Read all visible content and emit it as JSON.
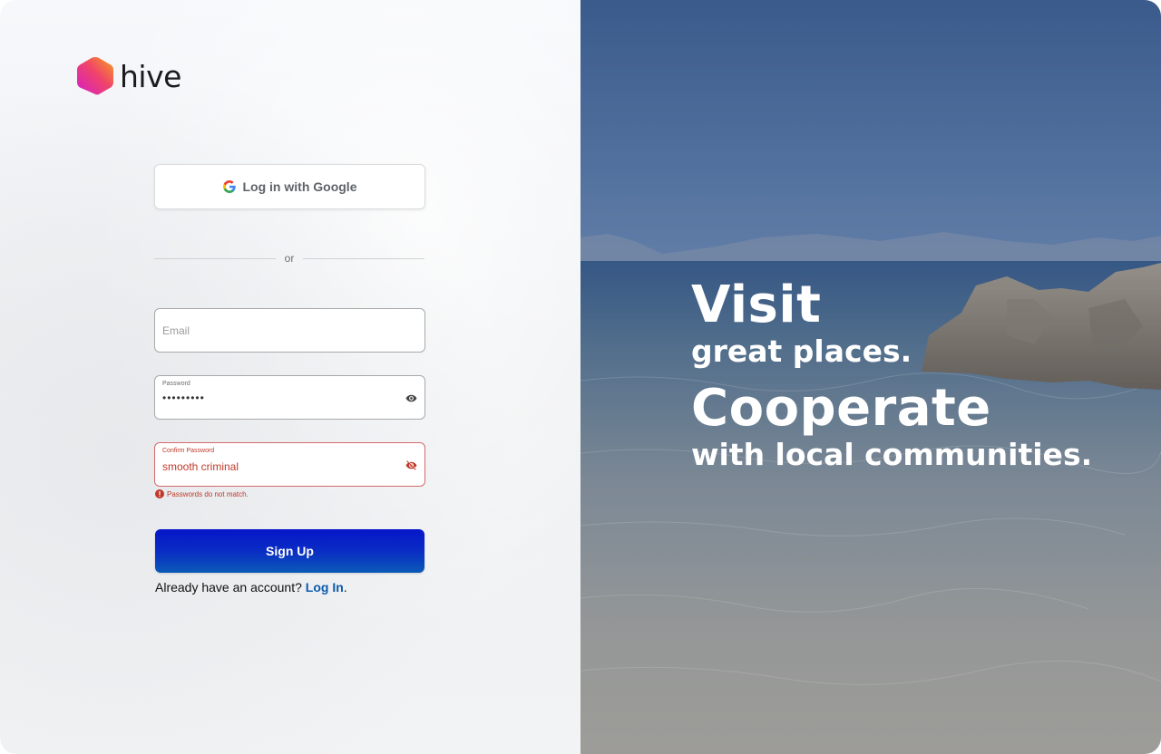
{
  "brand": {
    "name": "hive"
  },
  "auth": {
    "google_label": "Log in with Google",
    "divider_text": "or",
    "email": {
      "placeholder": "Email",
      "value": ""
    },
    "password": {
      "label": "Password",
      "value": "•••••••••"
    },
    "confirm_password": {
      "label": "Confirm Password",
      "value": "smooth criminal",
      "error": "Passwords do not match."
    },
    "signup_label": "Sign Up",
    "account_prompt": "Already have an account?",
    "login_link": "Log In",
    "login_suffix": "."
  },
  "hero": {
    "line1": "Visit",
    "line2": "great places.",
    "line3": "Cooperate",
    "line4": "with local communities."
  },
  "colors": {
    "primary": "#0a2cc4",
    "error": "#c0392b",
    "link": "#0b5cad"
  },
  "icons": [
    "hive-logo-icon",
    "google-icon",
    "eye-icon",
    "eye-off-icon",
    "error-icon"
  ]
}
